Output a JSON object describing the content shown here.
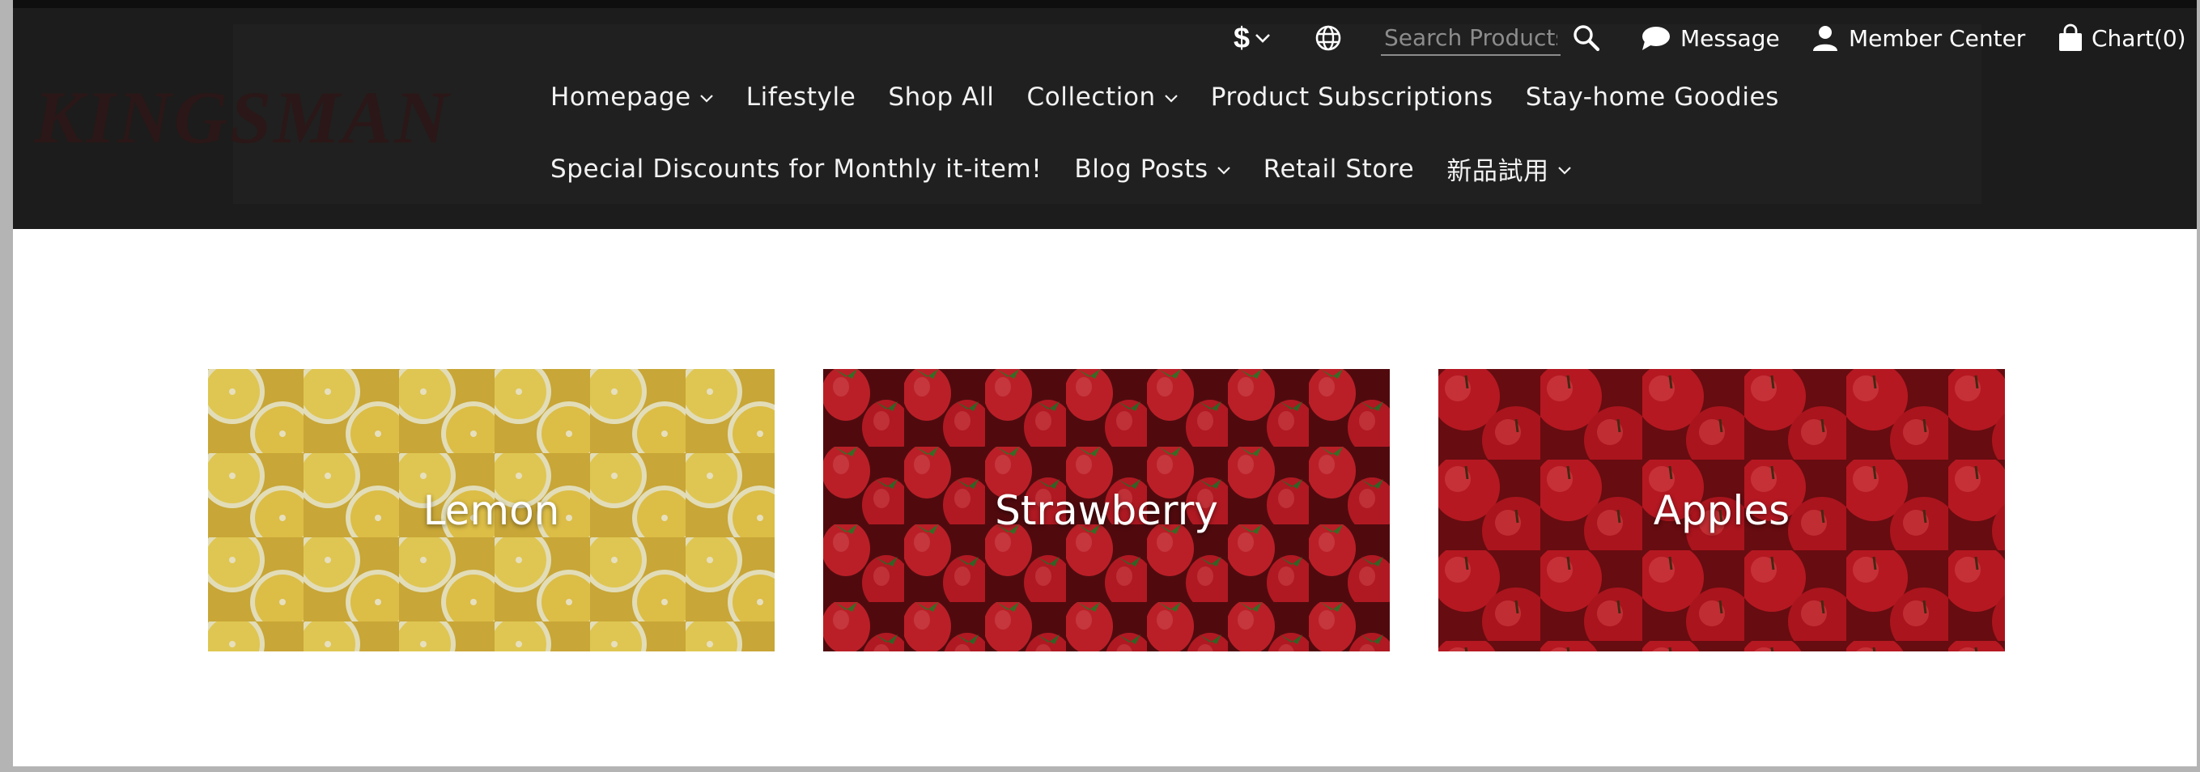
{
  "brand": {
    "logo_text": "KINGSMAN"
  },
  "utility": {
    "currency_symbol": "$",
    "search_placeholder": "Search Products",
    "message_label": "Message",
    "member_label": "Member Center",
    "cart_label": "Chart(0)",
    "icons": [
      "chevron-down-icon",
      "globe-icon",
      "search-icon",
      "chat-bubble-icon",
      "user-icon",
      "shopping-bag-icon"
    ]
  },
  "nav": {
    "row1": [
      {
        "label": "Homepage",
        "dropdown": true
      },
      {
        "label": "Lifestyle",
        "dropdown": false
      },
      {
        "label": "Shop All",
        "dropdown": false
      },
      {
        "label": "Collection",
        "dropdown": true
      },
      {
        "label": "Product Subscriptions",
        "dropdown": false
      },
      {
        "label": "Stay-home Goodies",
        "dropdown": false
      }
    ],
    "row2": [
      {
        "label": "Special Discounts for Monthly it-item!",
        "dropdown": false
      },
      {
        "label": "Blog Posts",
        "dropdown": true
      },
      {
        "label": "Retail Store",
        "dropdown": false
      },
      {
        "label": "新品試用",
        "dropdown": true
      }
    ]
  },
  "categories": [
    {
      "label": "Lemon"
    },
    {
      "label": "Strawberry"
    },
    {
      "label": "Apples"
    }
  ],
  "colors": {
    "header_bg": "#1c1c1c",
    "page_bg": "#ffffff",
    "frame": "#b4b4b4",
    "lemon": "#e8c64a",
    "strawberry": "#c8202a",
    "apple": "#b81822"
  }
}
